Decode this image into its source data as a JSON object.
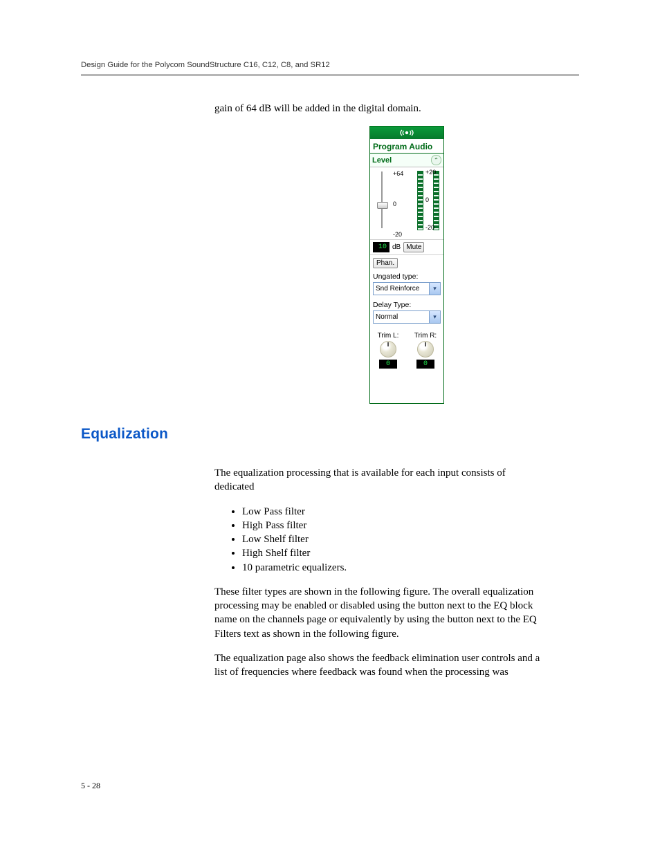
{
  "header": "Design Guide for the Polycom SoundStructure C16, C12, C8, and SR12",
  "page_number": "5 - 28",
  "body1": "gain of 64 dB will be added in the digital domain.",
  "section_title": "Equalization",
  "eq": {
    "intro": "The equalization processing that is available for each input consists of dedicated",
    "items": [
      "Low Pass filter",
      "High Pass filter",
      "Low Shelf filter",
      "High Shelf filter",
      "10 parametric equalizers."
    ],
    "p2": "These filter types are shown in the following figure. The overall equalization processing may be enabled or disabled using the button next to the EQ block name on the channels page or equivalently by using the button next to the EQ Filters text as shown in the following figure.",
    "p3": "The equalization page also shows the feedback elimination user controls and a list of frequencies where feedback was found when the processing was"
  },
  "panel": {
    "title": "Program Audio",
    "section_label": "Level",
    "scale": {
      "top": "+64",
      "mid": "0",
      "bot": "-20"
    },
    "meter_scale": {
      "top": "+20",
      "mid": "0",
      "bot": "-20"
    },
    "db_value": "10",
    "db_unit": "dB",
    "mute_label": "Mute",
    "phantom_label": "Phan.",
    "ungated_label": "Ungated type:",
    "ungated_value": "Snd Reinforce",
    "delay_label": "Delay Type:",
    "delay_value": "Normal",
    "trim_l_label": "Trim L:",
    "trim_r_label": "Trim R:",
    "trim_l_value": "0",
    "trim_r_value": "0"
  }
}
